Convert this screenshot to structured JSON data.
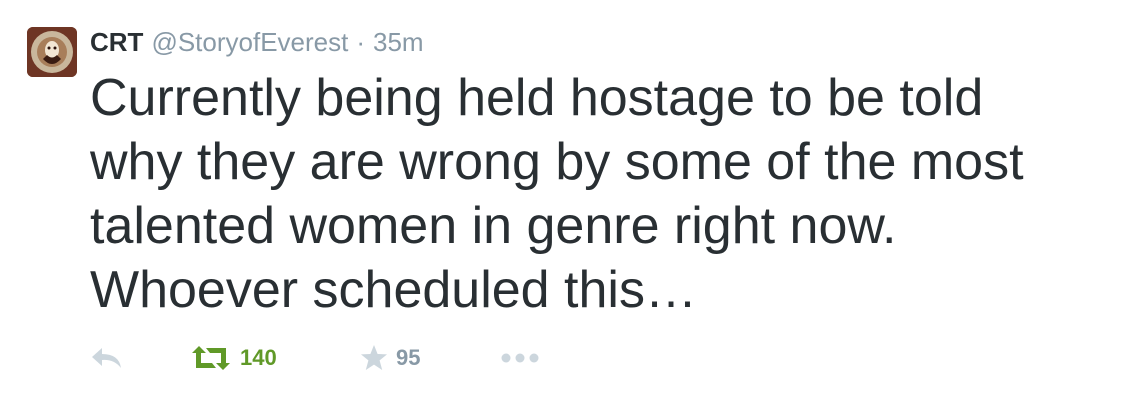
{
  "tweet": {
    "name": "CRT",
    "handle": "@StoryofEverest",
    "separator": "·",
    "time": "35m",
    "text_lines": [
      "Currently being held hostage to be told",
      "why they are wrong by some of the most",
      "talented women in genre right now.",
      "Whoever scheduled this…"
    ],
    "actions": {
      "reply_icon": "reply-icon",
      "retweet_icon": "retweet-icon",
      "retweet_count": "140",
      "retweet_color": "#609928",
      "favorite_icon": "star-icon",
      "favorite_count": "95",
      "favorite_color": "#8899a6",
      "more_icon": "more-dots-icon"
    }
  }
}
